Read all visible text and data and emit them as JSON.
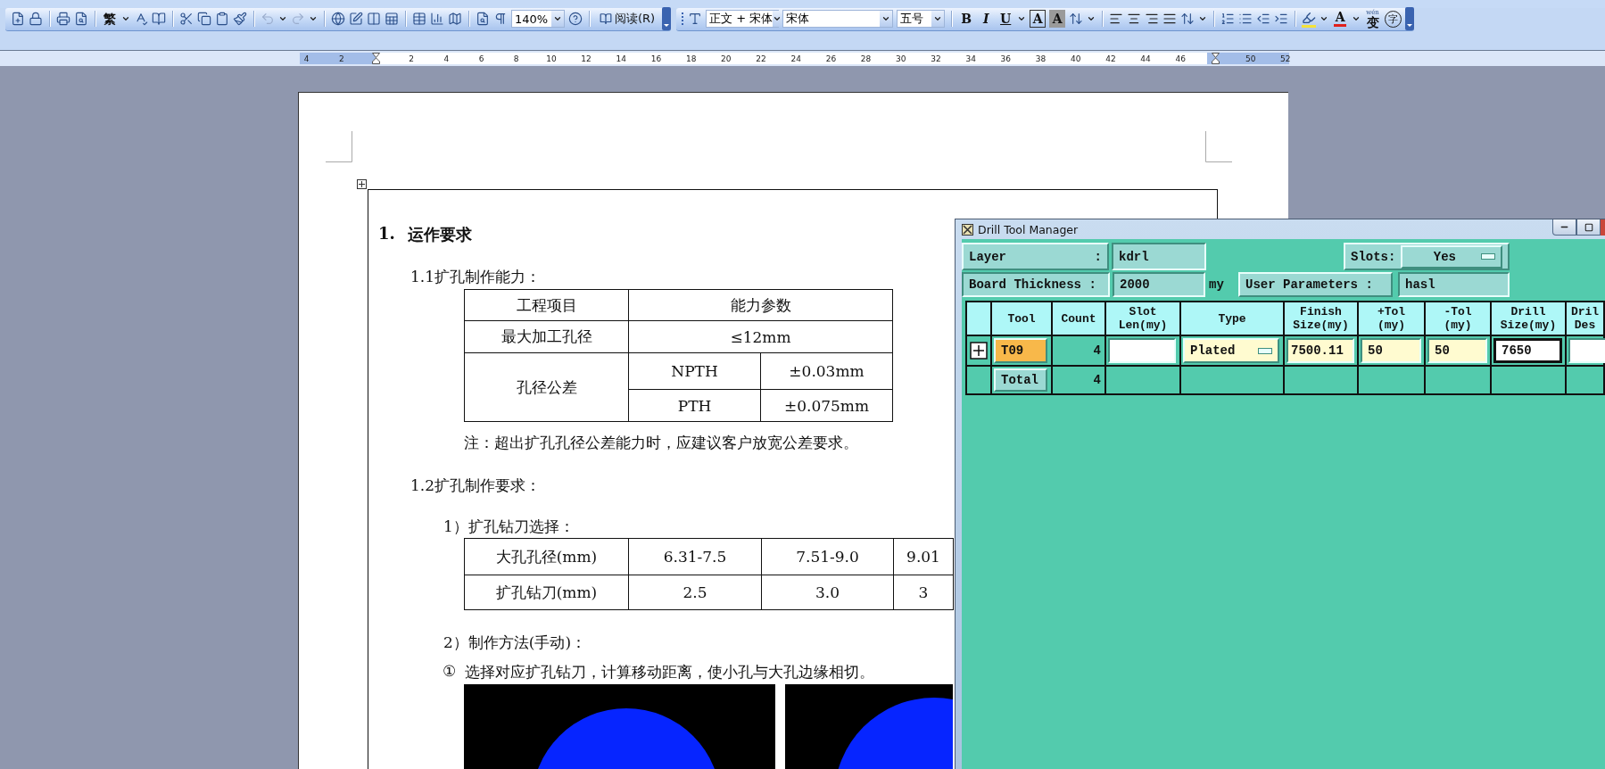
{
  "toolbar": {
    "convert_glyph": "繁",
    "zoom": "140%",
    "read_button": "阅读(R)",
    "style": "正文 + 宋体",
    "font": "宋体",
    "font_size": "五号",
    "bold": "B",
    "italic": "I",
    "underline": "U",
    "border_char": "A",
    "shading_char": "A",
    "font_color_char": "A",
    "phonetic_pinyin": "wén",
    "phonetic_char": "变",
    "enclose_char": "字"
  },
  "ruler": [
    {
      "kind": "number",
      "text": "4"
    },
    {
      "kind": "number",
      "text": "2"
    },
    {
      "kind": "indent"
    },
    {
      "kind": "number",
      "text": "2"
    },
    {
      "kind": "number",
      "text": "4"
    },
    {
      "kind": "number",
      "text": "6"
    },
    {
      "kind": "number",
      "text": "8"
    },
    {
      "kind": "number",
      "text": "10"
    },
    {
      "kind": "number",
      "text": "12"
    },
    {
      "kind": "number",
      "text": "14"
    },
    {
      "kind": "number",
      "text": "16"
    },
    {
      "kind": "number",
      "text": "18"
    },
    {
      "kind": "number",
      "text": "20"
    },
    {
      "kind": "number",
      "text": "22"
    },
    {
      "kind": "number",
      "text": "24"
    },
    {
      "kind": "number",
      "text": "26"
    },
    {
      "kind": "number",
      "text": "28"
    },
    {
      "kind": "number",
      "text": "30"
    },
    {
      "kind": "number",
      "text": "32"
    },
    {
      "kind": "number",
      "text": "34"
    },
    {
      "kind": "number",
      "text": "36"
    },
    {
      "kind": "number",
      "text": "38"
    },
    {
      "kind": "number",
      "text": "40"
    },
    {
      "kind": "number",
      "text": "42"
    },
    {
      "kind": "number",
      "text": "44"
    },
    {
      "kind": "number",
      "text": "46"
    },
    {
      "kind": "indent"
    },
    {
      "kind": "number",
      "text": "50"
    },
    {
      "kind": "number",
      "text": "52"
    }
  ],
  "document": {
    "heading_number": "1.",
    "heading": "运作要求",
    "section_1": "1.1扩孔制作能力：",
    "capability_table": {
      "columns": [
        "工程项目",
        "能力参数"
      ],
      "max_diameter": {
        "label": "最大加工孔径",
        "value": "≤12mm"
      },
      "tolerance": {
        "label": "孔径公差",
        "items": [
          {
            "type": "NPTH",
            "value": "±0.03mm"
          },
          {
            "type": "PTH",
            "value": "±0.075mm"
          }
        ]
      }
    },
    "note": "注：超出扩孔孔径公差能力时，应建议客户放宽公差要求。",
    "section_2": "1.2扩孔制作要求：",
    "step_1": "1）扩孔钻刀选择：",
    "drill_table": [
      [
        "大孔孔径(mm)",
        "6.31-7.5",
        "7.51-9.0",
        "9.01"
      ],
      [
        "扩孔钻刀(mm)",
        "2.5",
        "3.0",
        "3"
      ]
    ],
    "step_2": "2）制作方法(手动)：",
    "instruction_number": "①",
    "instruction": "选择对应扩孔钻刀，计算移动距离，使小孔与大孔边缘相切。"
  },
  "dialog": {
    "title": "Drill Tool Manager",
    "layer_label": "Layer",
    "layer_colon": ":",
    "layer": "kdrl",
    "slots_label": "Slots:",
    "slots": "Yes",
    "thickness_label": "Board Thickness :",
    "thickness": "2000",
    "thickness_unit": "my",
    "user_params_button": "User Parameters :",
    "user_params": "hasl",
    "columns": [
      "Tool",
      "Count",
      "Slot\nLen(my)",
      "Type",
      "Finish\nSize(my)",
      "+Tol\n(my)",
      "-Tol\n(my)",
      "Drill\nSize(my)",
      "Dril\nDes"
    ],
    "tools": [
      {
        "expanded": false,
        "tool": "T09",
        "selected": true,
        "count": "4",
        "type": "Plated",
        "finish": "7500.11",
        "plus_tol": "50",
        "minus_tol": "50",
        "drill": "7650"
      }
    ],
    "total": {
      "label": "Total",
      "count": "4"
    }
  }
}
